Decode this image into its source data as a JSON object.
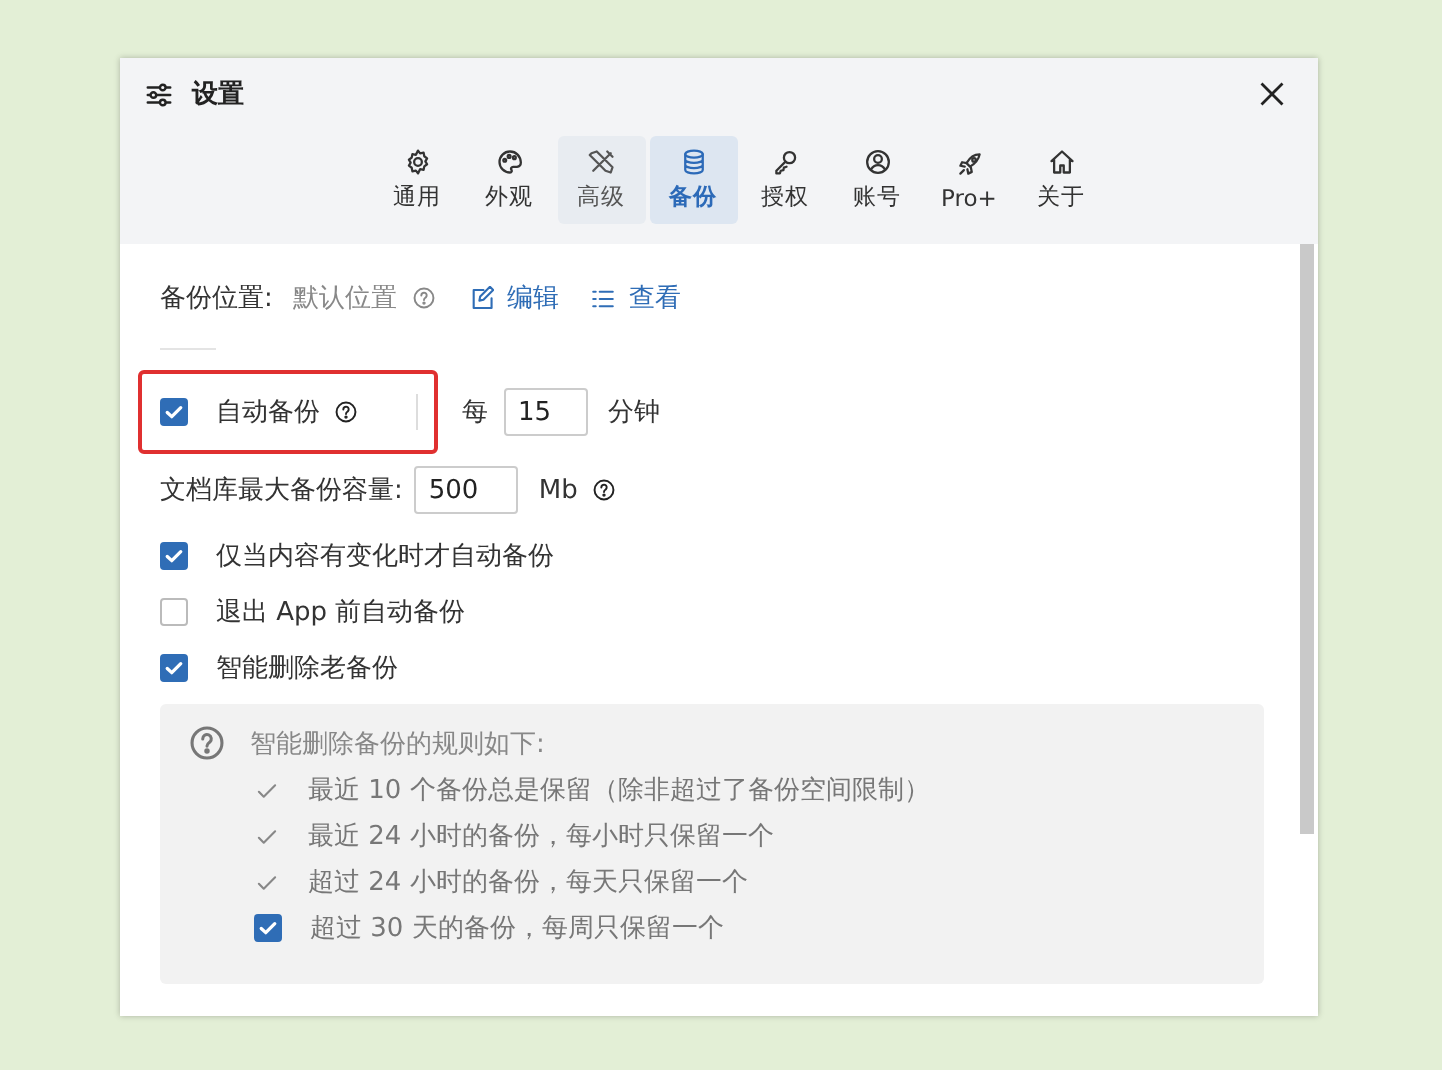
{
  "window": {
    "title": "设置"
  },
  "tabs": [
    {
      "label": "通用",
      "selected": false,
      "hovered": false
    },
    {
      "label": "外观",
      "selected": false,
      "hovered": false
    },
    {
      "label": "高级",
      "selected": false,
      "hovered": true
    },
    {
      "label": "备份",
      "selected": true,
      "hovered": false
    },
    {
      "label": "授权",
      "selected": false,
      "hovered": false
    },
    {
      "label": "账号",
      "selected": false,
      "hovered": false
    },
    {
      "label": "Pro+",
      "selected": false,
      "hovered": false
    },
    {
      "label": "关于",
      "selected": false,
      "hovered": false
    }
  ],
  "backup_location": {
    "label": "备份位置:",
    "value": "默认位置",
    "actions": [
      {
        "label": "编辑"
      },
      {
        "label": "查看"
      }
    ]
  },
  "auto_backup": {
    "label": "自动备份",
    "checked": true,
    "prefix": "每",
    "interval": "15",
    "unit": "分钟"
  },
  "max_capacity": {
    "label": "文档库最大备份容量:",
    "value": "500",
    "unit": "Mb"
  },
  "options": [
    {
      "label": "仅当内容有变化时才自动备份",
      "checked": true
    },
    {
      "label": "退出 App 前自动备份",
      "checked": false
    },
    {
      "label": "智能删除老备份",
      "checked": true
    }
  ],
  "rules": {
    "title": "智能删除备份的规则如下:",
    "items": [
      {
        "kind": "check",
        "text": "最近 10 个备份总是保留（除非超过了备份空间限制）"
      },
      {
        "kind": "check",
        "text": "最近 24 小时的备份，每小时只保留一个"
      },
      {
        "kind": "check",
        "text": "超过 24 小时的备份，每天只保留一个"
      },
      {
        "kind": "checkbox",
        "text": "超过 30 天的备份，每周只保留一个",
        "checked": true
      }
    ]
  }
}
